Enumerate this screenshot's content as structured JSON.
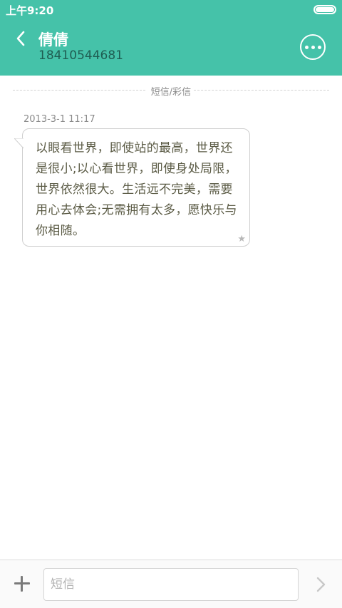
{
  "status_bar": {
    "time": "上午9:20"
  },
  "header": {
    "contact_name": "倩倩",
    "contact_number": "18410544681"
  },
  "thread": {
    "type_label": "短信/彩信",
    "messages": [
      {
        "timestamp": "2013-3-1 11:17",
        "text": "以眼看世界，即使站的最高，世界还是很小;以心看世界，即使身处局限，世界依然很大。生活远不完美，需要用心去体会;无需拥有太多，愿快乐与你相随。",
        "starred": true
      }
    ]
  },
  "compose": {
    "placeholder": "短信"
  },
  "colors": {
    "accent": "#45c2a9",
    "number_text": "#1f5d52",
    "bubble_text": "#5b5b45"
  },
  "icons": {
    "back": "chevron-left-icon",
    "more": "more-dots-icon",
    "add": "plus-icon",
    "send": "chevron-right-icon",
    "star": "star-icon",
    "battery": "battery-icon"
  }
}
